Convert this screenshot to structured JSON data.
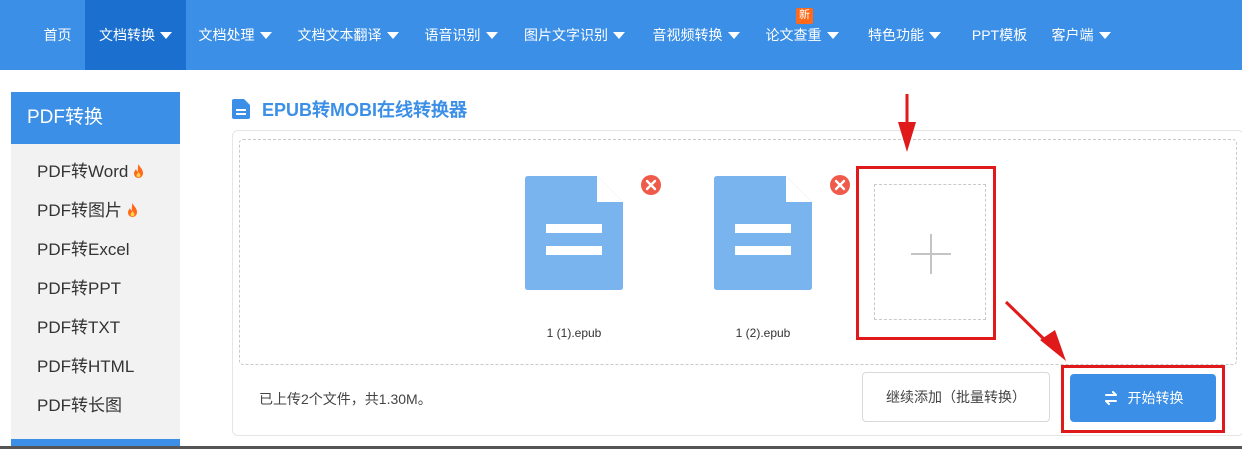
{
  "nav": {
    "items": [
      {
        "label": "首页",
        "caret": false,
        "active": false
      },
      {
        "label": "文档转换",
        "caret": true,
        "active": true
      },
      {
        "label": "文档处理",
        "caret": true,
        "active": false
      },
      {
        "label": "文档文本翻译",
        "caret": true,
        "active": false
      },
      {
        "label": "语音识别",
        "caret": true,
        "active": false
      },
      {
        "label": "图片文字识别",
        "caret": true,
        "active": false
      },
      {
        "label": "音视频转换",
        "caret": true,
        "active": false
      },
      {
        "label": "论文查重",
        "caret": true,
        "active": false,
        "badge": "新"
      },
      {
        "label": "特色功能",
        "caret": true,
        "active": false
      },
      {
        "label": "PPT模板",
        "caret": false,
        "active": false
      },
      {
        "label": "客户端",
        "caret": true,
        "active": false
      }
    ]
  },
  "sidebar": {
    "title": "PDF转换",
    "items": [
      {
        "label": "PDF转Word",
        "hot": true
      },
      {
        "label": "PDF转图片",
        "hot": true
      },
      {
        "label": "PDF转Excel",
        "hot": false
      },
      {
        "label": "PDF转PPT",
        "hot": false
      },
      {
        "label": "PDF转TXT",
        "hot": false
      },
      {
        "label": "PDF转HTML",
        "hot": false
      },
      {
        "label": "PDF转长图",
        "hot": false
      }
    ]
  },
  "main": {
    "title": "EPUB转MOBI在线转换器",
    "files": [
      {
        "name": "1 (1).epub"
      },
      {
        "name": "1 (2).epub"
      }
    ],
    "status": "已上传2个文件，共1.30M。",
    "continue_label": "继续添加（批量转换）",
    "start_label": "开始转换"
  },
  "colors": {
    "brand": "#3b8fe6",
    "brand_dark": "#1a6fcf",
    "remove": "#f05a4a",
    "annotation": "#e01a1a",
    "file_icon": "#7ab4ef"
  }
}
